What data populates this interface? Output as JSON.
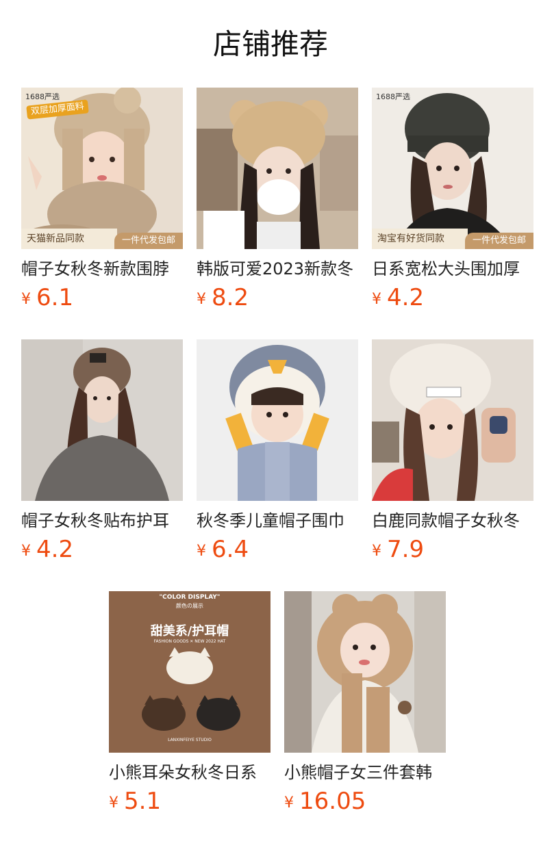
{
  "page": {
    "title": "店铺推荐"
  },
  "colors": {
    "price": "#ee4b10",
    "tag_bg": "#f3ead9",
    "tag_right_bg": "#c49a6a"
  },
  "products": [
    {
      "name": "帽子女秋冬新款围脖",
      "currency": "¥",
      "price": "6.1",
      "badge": "1688严选",
      "promo": "双层加厚面料",
      "tag_left": "天猫新品同款",
      "tag_right": "一件代发包邮",
      "image": "woman-fur-bomber-hat-photo"
    },
    {
      "name": "韩版可爱2023新款冬",
      "currency": "¥",
      "price": "8.2",
      "image": "woman-bear-ear-hat-mask-photo"
    },
    {
      "name": "日系宽松大头围加厚",
      "currency": "¥",
      "price": "4.2",
      "badge": "1688严选",
      "tag_left": "淘宝有好货同款",
      "tag_right": "一件代发包邮",
      "image": "woman-dark-knit-beanie-photo"
    },
    {
      "name": "帽子女秋冬贴布护耳",
      "currency": "¥",
      "price": "4.2",
      "image": "woman-brown-knit-beanie-photo"
    },
    {
      "name": "秋冬季儿童帽子围巾",
      "currency": "¥",
      "price": "6.4",
      "image": "child-penguin-hat-scarf-photo"
    },
    {
      "name": "白鹿同款帽子女秋冬",
      "currency": "¥",
      "price": "7.9",
      "image": "woman-white-fluffy-hat-photo"
    },
    {
      "name": "小熊耳朵女秋冬日系",
      "currency": "¥",
      "price": "5.1",
      "poster_header": "\"COLOR DISPLAY\"",
      "poster_sub": "颜色の展示",
      "poster_title": "甜美系/护耳帽",
      "poster_tagline": "FASHION GOODS ✕ NEW 2022 HAT",
      "poster_brand": "LANXINFEIYE STUDIO",
      "image": "bear-ear-hats-color-display-poster"
    },
    {
      "name": "小熊帽子女三件套韩",
      "currency": "¥",
      "price": "16.05",
      "image": "woman-bear-hood-scarf-set-photo"
    }
  ]
}
